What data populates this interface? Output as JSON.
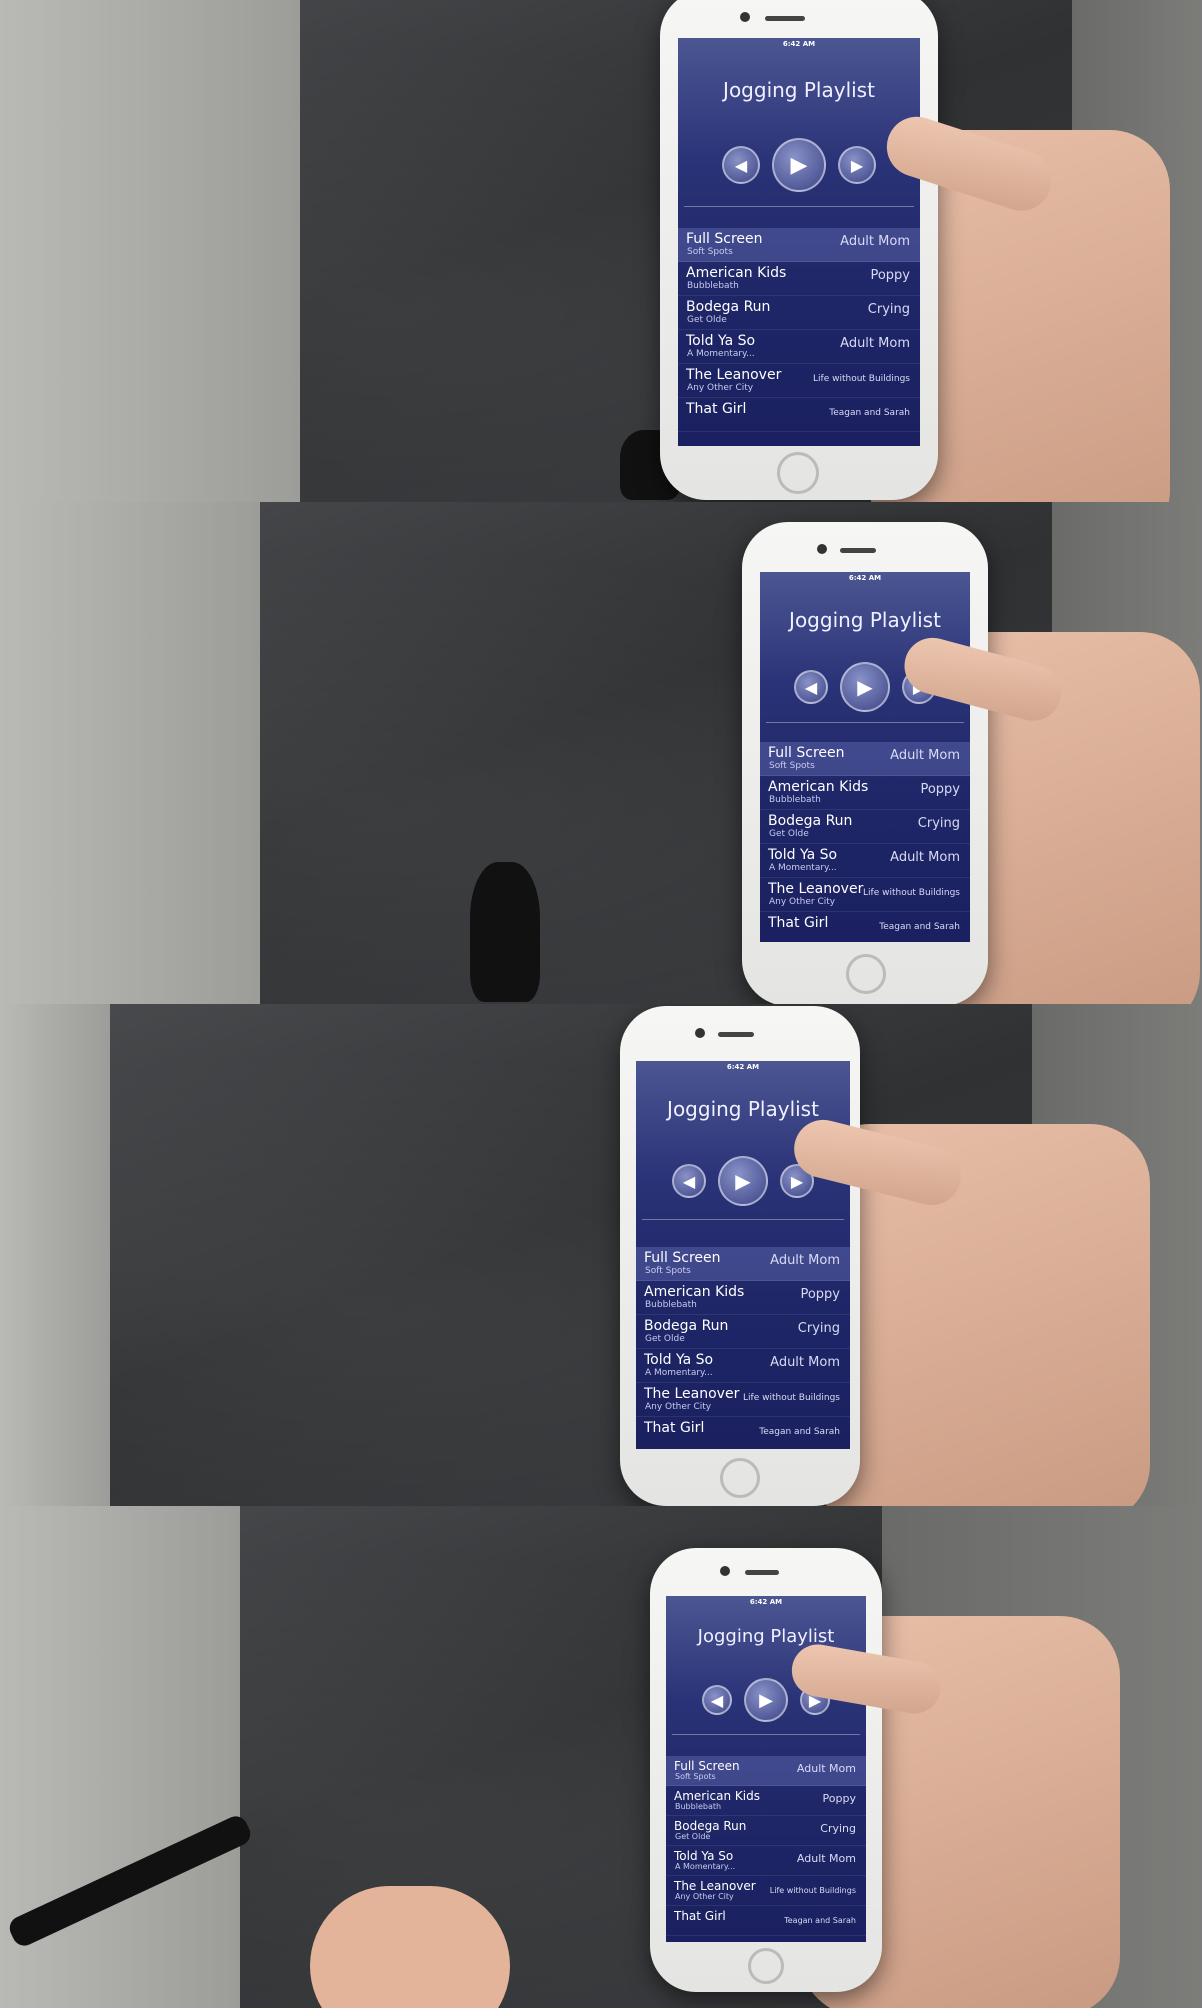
{
  "app": {
    "status_time": "6:42 AM",
    "title": "Jogging Playlist",
    "controls": {
      "prev_icon": "previous-icon",
      "play_icon": "play-icon",
      "next_icon": "next-icon"
    },
    "songs": [
      {
        "title": "Full Screen",
        "album": "Soft Spots",
        "artist": "Adult Mom"
      },
      {
        "title": "American Kids",
        "album": "Bubblebath",
        "artist": "Poppy"
      },
      {
        "title": "Bodega Run",
        "album": "Get Olde",
        "artist": "Crying"
      },
      {
        "title": "Told Ya So",
        "album": "A Momentary...",
        "artist": "Adult Mom"
      },
      {
        "title": "The Leanover",
        "album": "Any Other City",
        "artist": "Life without Buildings"
      },
      {
        "title": "That Girl",
        "album": "",
        "artist": "Teagan and Sarah"
      }
    ]
  },
  "colors": {
    "screen_top": "#4c5692",
    "screen_bottom": "#1a2060",
    "selected_row": "#6f78c0"
  }
}
